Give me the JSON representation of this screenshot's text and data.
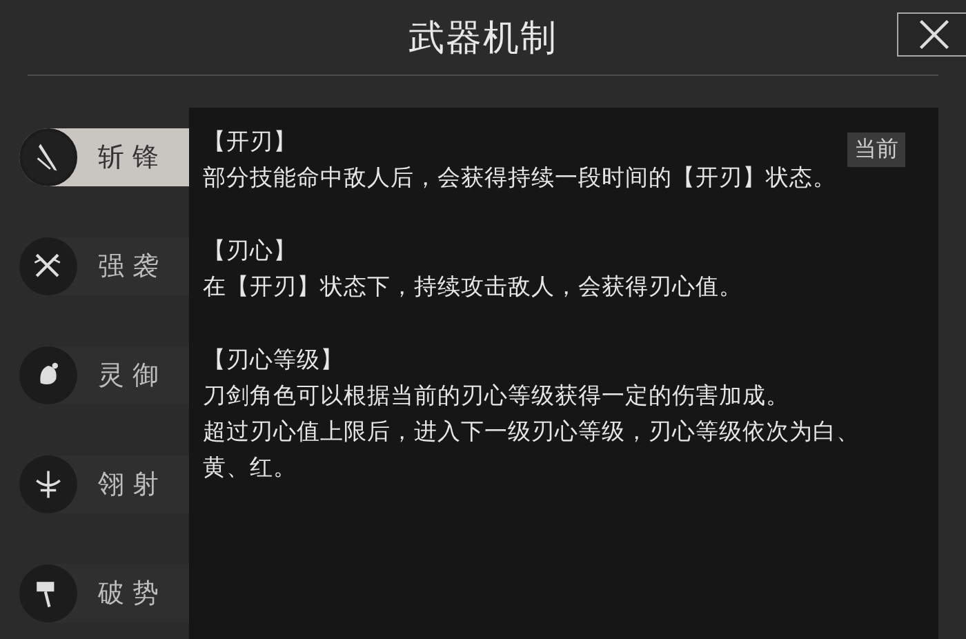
{
  "window": {
    "title": "武器机制"
  },
  "sidebar": {
    "items": [
      {
        "label": "斩锋",
        "selected": true
      },
      {
        "label": "强袭",
        "selected": false
      },
      {
        "label": "灵御",
        "selected": false
      },
      {
        "label": "翎射",
        "selected": false
      },
      {
        "label": "破势",
        "selected": false
      }
    ]
  },
  "content": {
    "badge": "当前",
    "sections": [
      {
        "heading": "【开刃】",
        "lines": [
          "部分技能命中敌人后，会获得持续一段时间的【开刃】状态。"
        ]
      },
      {
        "heading": "【刃心】",
        "lines": [
          "在【开刃】状态下，持续攻击敌人，会获得刃心值。"
        ]
      },
      {
        "heading": "【刃心等级】",
        "lines": [
          "刀剑角色可以根据当前的刃心等级获得一定的伤害加成。",
          "超过刃心值上限后，进入下一级刃心等级，刃心等级依次为白、黄、红。"
        ]
      }
    ]
  }
}
